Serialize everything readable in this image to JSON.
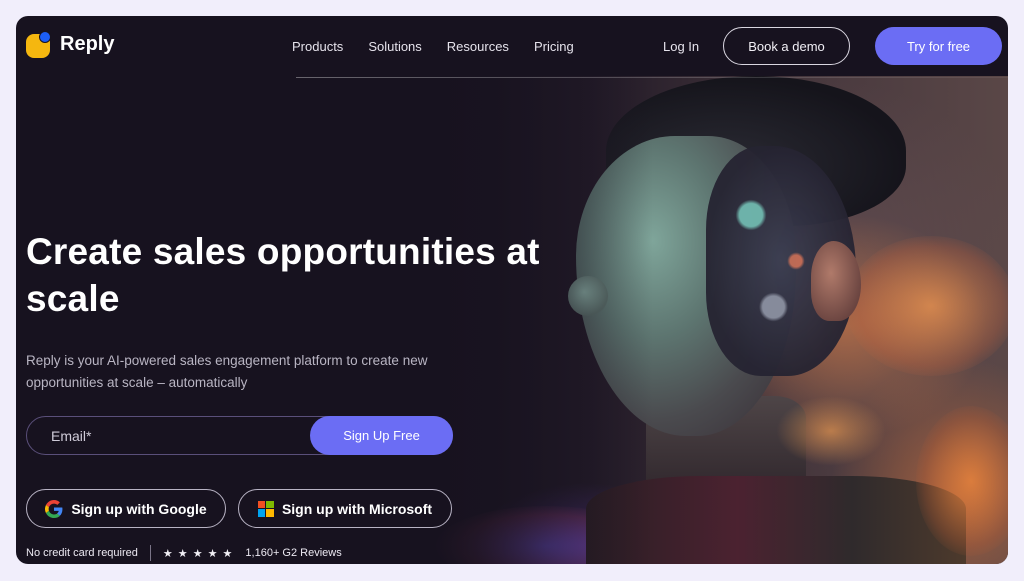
{
  "brand": {
    "name": "Reply",
    "logo_colors": {
      "square": "#f5b70f",
      "dot": "#1c5ef5"
    }
  },
  "nav": {
    "menu": [
      {
        "label": "Products"
      },
      {
        "label": "Solutions"
      },
      {
        "label": "Resources"
      },
      {
        "label": "Pricing"
      }
    ],
    "login_label": "Log In",
    "demo_label": "Book a demo",
    "try_label": "Try for free"
  },
  "hero": {
    "headline": "Create sales opportunities at scale",
    "subheadline": "Reply is your AI-powered sales engagement platform to create new opportunities at scale – automatically",
    "email_placeholder": "Email*",
    "email_value": "",
    "signup_label": "Sign Up Free",
    "google_label": "Sign up with Google",
    "microsoft_label": "Sign up with Microsoft",
    "no_card_text": "No credit card required",
    "rating_stars": 5,
    "stars_glyph": "★ ★ ★ ★ ★",
    "reviews_text": "1,160+ G2 Reviews",
    "hero_image": "ai-portrait-illustration"
  },
  "colors": {
    "accent": "#6b6df4",
    "background": "#17121f",
    "page": "#f1eefb"
  }
}
